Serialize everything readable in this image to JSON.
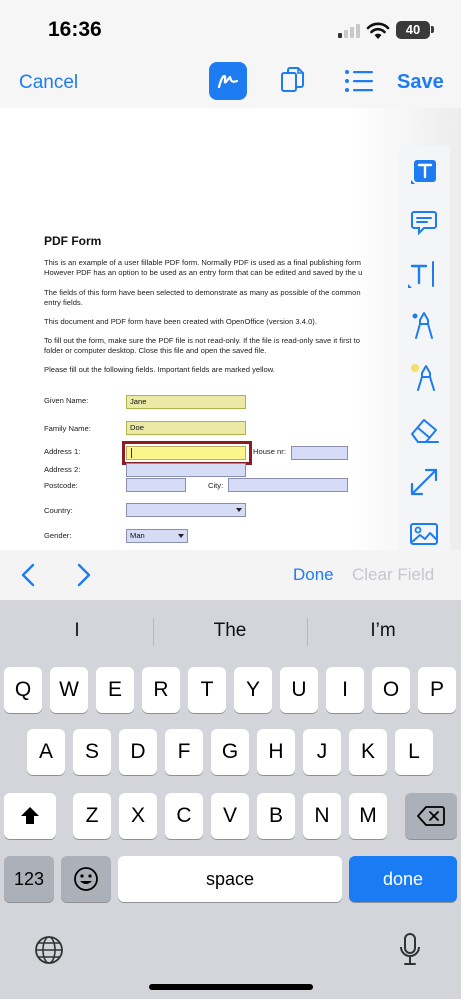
{
  "status_bar": {
    "time": "16:36",
    "battery": "40"
  },
  "toolbar": {
    "cancel_label": "Cancel",
    "save_label": "Save",
    "active_tool": "signature"
  },
  "pdf": {
    "title": "PDF Form",
    "paragraphs": [
      "This is an example of a user fillable PDF form. Normally PDF is used as a final publishing form",
      "However PDF has an option to be used as an entry form that can be edited and saved by the u",
      "The fields of this form have been selected to demonstrate as many as possible of the common",
      "entry fields.",
      "This document and PDF form have been created with OpenOffice (version 3.4.0).",
      "To fill out the form, make sure the PDF file is not read-only. If the file is read-only save it first to",
      "folder or computer desktop. Close this file and open the saved file.",
      "Please fill out the following fields. Important fields are marked yellow."
    ],
    "labels": {
      "given_name": "Given Name:",
      "family_name": "Family Name:",
      "address1": "Address 1:",
      "house_nr": "House nr:",
      "address2": "Address 2:",
      "postcode": "Postcode:",
      "city": "City:",
      "country": "Country:",
      "gender": "Gender:"
    },
    "values": {
      "given_name": "Jane",
      "family_name": "Doe",
      "address1": "",
      "house_nr": "",
      "address2": "",
      "postcode": "",
      "city": "",
      "country": "",
      "gender": "Man"
    }
  },
  "tools": [
    "text-box",
    "comment",
    "text-insert",
    "pen",
    "highlighter",
    "eraser",
    "arrow",
    "image"
  ],
  "form_nav": {
    "done_label": "Done",
    "clear_label": "Clear Field"
  },
  "keyboard": {
    "suggestions": [
      "I",
      "The",
      "I’m"
    ],
    "row1": [
      "Q",
      "W",
      "E",
      "R",
      "T",
      "Y",
      "U",
      "I",
      "O",
      "P"
    ],
    "row2": [
      "A",
      "S",
      "D",
      "F",
      "G",
      "H",
      "J",
      "K",
      "L"
    ],
    "row3": [
      "Z",
      "X",
      "C",
      "V",
      "B",
      "N",
      "M"
    ],
    "numbers_label": "123",
    "space_label": "space",
    "return_label": "done"
  },
  "colors": {
    "accent": "#1e7cf2",
    "required_field": "#eaeaa6",
    "optional_field": "#d7dcf6",
    "focus_frame": "#8b1c24"
  }
}
